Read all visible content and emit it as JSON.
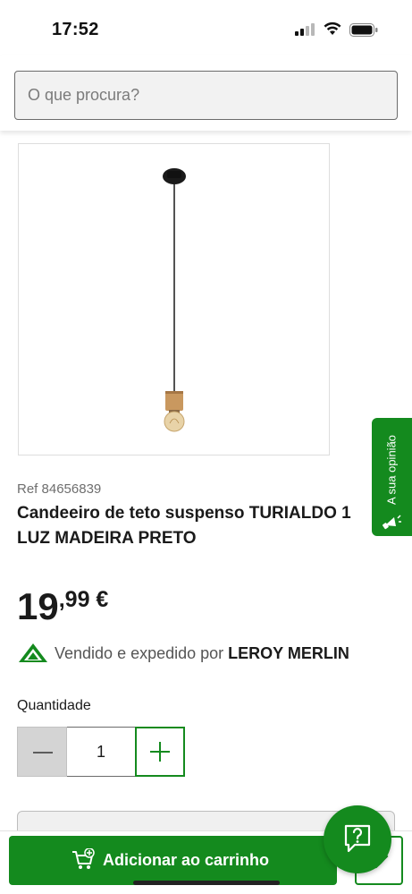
{
  "status_bar": {
    "time": "17:52"
  },
  "search": {
    "placeholder": "O que procura?"
  },
  "feedback": {
    "label": "A sua opinião"
  },
  "product": {
    "ref": "Ref 84656839",
    "title": "Candeeiro de teto suspenso TURIALDO 1 LUZ MADEIRA PRETO",
    "price_int": "19",
    "price_dec": ",99 €"
  },
  "seller": {
    "prefix": "Vendido e expedido por ",
    "name": "LEROY MERLIN",
    "logo_text": "LEROY MERLIN"
  },
  "quantity": {
    "label": "Quantidade",
    "value": "1"
  },
  "actions": {
    "add_to_cart": "Adicionar ao carrinho"
  },
  "icons": {
    "search": "search-input",
    "feedback": "megaphone-icon",
    "cart": "cart-add-icon",
    "help": "help-chat-icon",
    "wishlist": "edit-icon"
  },
  "colors": {
    "brand_green": "#148a1e",
    "text": "#1a1a1a",
    "muted": "#6e6e6e"
  }
}
